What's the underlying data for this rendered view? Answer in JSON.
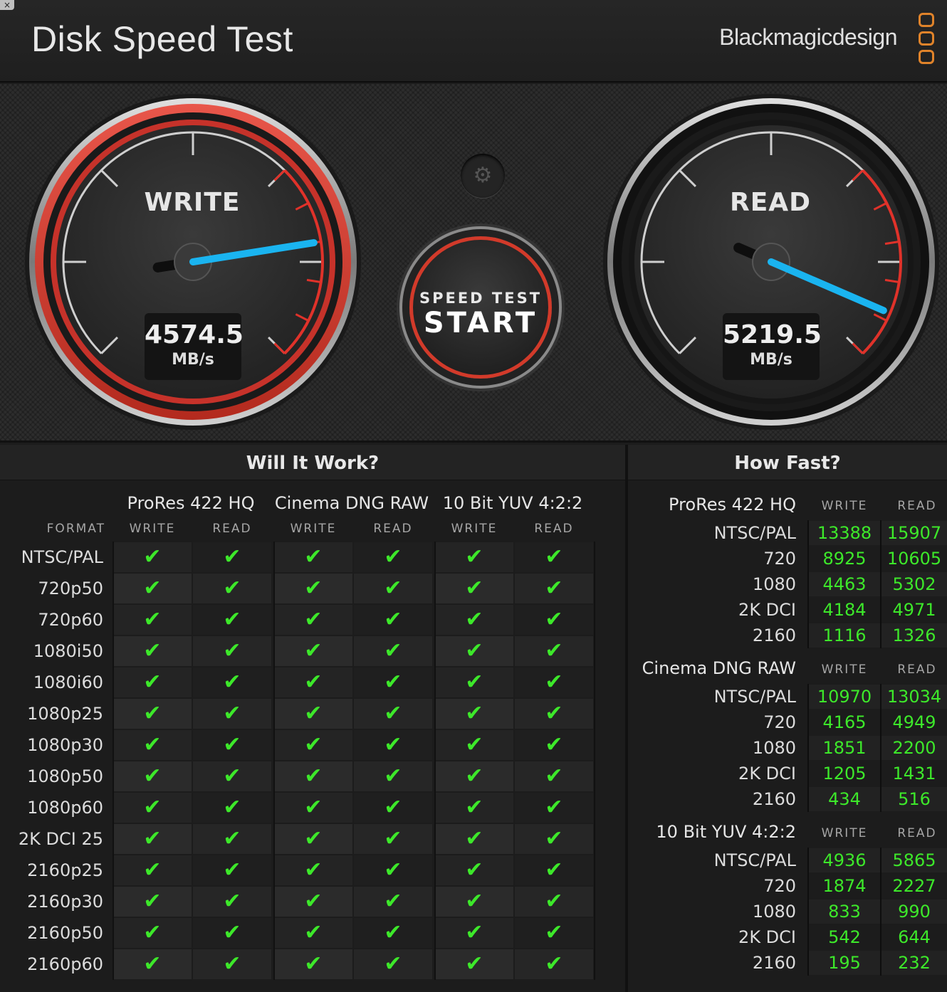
{
  "window": {
    "title": "Disk Speed Test",
    "close_glyph": "×",
    "brand": "Blackmagicdesign"
  },
  "gauges": {
    "write": {
      "label": "WRITE",
      "value": "4574.5",
      "unit": "MB/s",
      "needle_fraction": 0.8
    },
    "read": {
      "label": "READ",
      "value": "5219.5",
      "unit": "MB/s",
      "needle_fraction": 0.92
    }
  },
  "start_button": {
    "line1": "SPEED TEST",
    "line2": "START"
  },
  "settings_icon": "gear-icon",
  "colors": {
    "accent_red": "#d23a2a",
    "needle_blue": "#1ab4f0",
    "check_green": "#3de82a",
    "brand_orange": "#e0832a"
  },
  "will_it_work": {
    "title": "Will It Work?",
    "format_header": "FORMAT",
    "groups": [
      {
        "name": "ProRes 422 HQ",
        "write": "WRITE",
        "read": "READ"
      },
      {
        "name": "Cinema DNG RAW",
        "write": "WRITE",
        "read": "READ"
      },
      {
        "name": "10 Bit YUV 4:2:2",
        "write": "WRITE",
        "read": "READ"
      }
    ],
    "rows": [
      "NTSC/PAL",
      "720p50",
      "720p60",
      "1080i50",
      "1080i60",
      "1080p25",
      "1080p30",
      "1080p50",
      "1080p60",
      "2K DCI 25",
      "2160p25",
      "2160p30",
      "2160p50",
      "2160p60"
    ],
    "check_glyph": "✔"
  },
  "how_fast": {
    "title": "How Fast?",
    "groups": [
      {
        "name": "ProRes 422 HQ",
        "write": "WRITE",
        "read": "READ",
        "rows": [
          {
            "format": "NTSC/PAL",
            "write": "13388",
            "read": "15907"
          },
          {
            "format": "720",
            "write": "8925",
            "read": "10605"
          },
          {
            "format": "1080",
            "write": "4463",
            "read": "5302"
          },
          {
            "format": "2K DCI",
            "write": "4184",
            "read": "4971"
          },
          {
            "format": "2160",
            "write": "1116",
            "read": "1326"
          }
        ]
      },
      {
        "name": "Cinema DNG RAW",
        "write": "WRITE",
        "read": "READ",
        "rows": [
          {
            "format": "NTSC/PAL",
            "write": "10970",
            "read": "13034"
          },
          {
            "format": "720",
            "write": "4165",
            "read": "4949"
          },
          {
            "format": "1080",
            "write": "1851",
            "read": "2200"
          },
          {
            "format": "2K DCI",
            "write": "1205",
            "read": "1431"
          },
          {
            "format": "2160",
            "write": "434",
            "read": "516"
          }
        ]
      },
      {
        "name": "10 Bit YUV 4:2:2",
        "write": "WRITE",
        "read": "READ",
        "rows": [
          {
            "format": "NTSC/PAL",
            "write": "4936",
            "read": "5865"
          },
          {
            "format": "720",
            "write": "1874",
            "read": "2227"
          },
          {
            "format": "1080",
            "write": "833",
            "read": "990"
          },
          {
            "format": "2K DCI",
            "write": "542",
            "read": "644"
          },
          {
            "format": "2160",
            "write": "195",
            "read": "232"
          }
        ]
      }
    ]
  }
}
